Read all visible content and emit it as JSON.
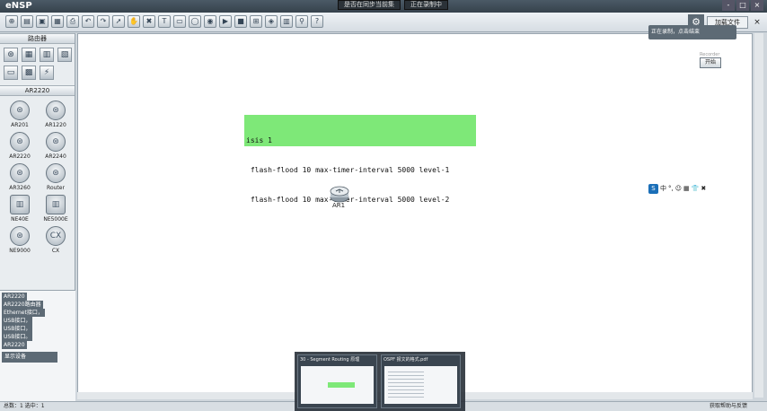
{
  "window": {
    "app_title": "eNSP",
    "center_tabs": [
      "是否在同步当前集",
      "正在录制中"
    ],
    "controls": [
      "-",
      "□",
      "×"
    ]
  },
  "toolbar": {
    "icons": [
      "new-icon",
      "open-icon",
      "save-icon",
      "save-as-icon",
      "print-icon",
      "undo-icon",
      "redo-icon",
      "pointer-icon",
      "hand-icon",
      "delete-icon",
      "text-icon",
      "rect-icon",
      "ellipse-icon",
      "capture-icon",
      "start-all-icon",
      "stop-all-icon",
      "topo-icon",
      "palette-icon",
      "terminal-icon",
      "zoom-icon",
      "help-icon"
    ],
    "glyphs": [
      "⊕",
      "▤",
      "▣",
      "▦",
      "⎙",
      "↶",
      "↷",
      "➚",
      "✋",
      "✖",
      "T",
      "▭",
      "◯",
      "◉",
      "▶",
      "■",
      "⊞",
      "◈",
      "▥",
      "⚲",
      "?"
    ],
    "menu_label": "加载文件",
    "gear_glyph": "⚙",
    "close_glyph": "×"
  },
  "left_panel": {
    "category_header": "路由器",
    "category_glyphs": [
      "⊛",
      "▦",
      "▥",
      "▧",
      "▭",
      "▩",
      "⚡"
    ],
    "device_header": "AR2220",
    "devices": [
      {
        "label": "AR201",
        "glyph": "⊛",
        "shape": "round"
      },
      {
        "label": "AR1220",
        "glyph": "⊛",
        "shape": "round"
      },
      {
        "label": "AR2220",
        "glyph": "⊛",
        "shape": "round"
      },
      {
        "label": "AR2240",
        "glyph": "⊛",
        "shape": "round"
      },
      {
        "label": "AR3260",
        "glyph": "⊛",
        "shape": "round"
      },
      {
        "label": "Router",
        "glyph": "⊛",
        "shape": "round"
      },
      {
        "label": "NE40E",
        "glyph": "▥",
        "shape": "box"
      },
      {
        "label": "NE5000E",
        "glyph": "▥",
        "shape": "box"
      },
      {
        "label": "NE9000",
        "glyph": "⊛",
        "shape": "round"
      },
      {
        "label": "CX",
        "glyph": "CX",
        "shape": "round"
      }
    ],
    "description": {
      "lines": [
        "AR2220",
        "AR2220路由器",
        "Ethernet接口，",
        "USB接口，",
        "USB接口，",
        "USB接口。",
        "AR2220"
      ],
      "button_label": "显示设备"
    }
  },
  "canvas": {
    "command_lines": [
      "isis 1",
      " flash-flood 10 max-timer-interval 5000 level-1",
      " flash-flood 10 max-timer-interval 5000 level-2"
    ],
    "router_label": "AR1",
    "top_note": "正在录制，点击结束",
    "start_title": "Recorder",
    "start_button": "开始",
    "ime": {
      "logo": "S",
      "items": [
        "中",
        "°,",
        "☺",
        "▦",
        "👕",
        "✖"
      ]
    }
  },
  "statusbar": {
    "left": "总数：1 选中：1",
    "right": "获取帮助与反馈"
  },
  "taskbar_previews": [
    {
      "title": "30 - Segment Routing 原理"
    },
    {
      "title": "OSPF 报文的格式.pdf"
    }
  ]
}
